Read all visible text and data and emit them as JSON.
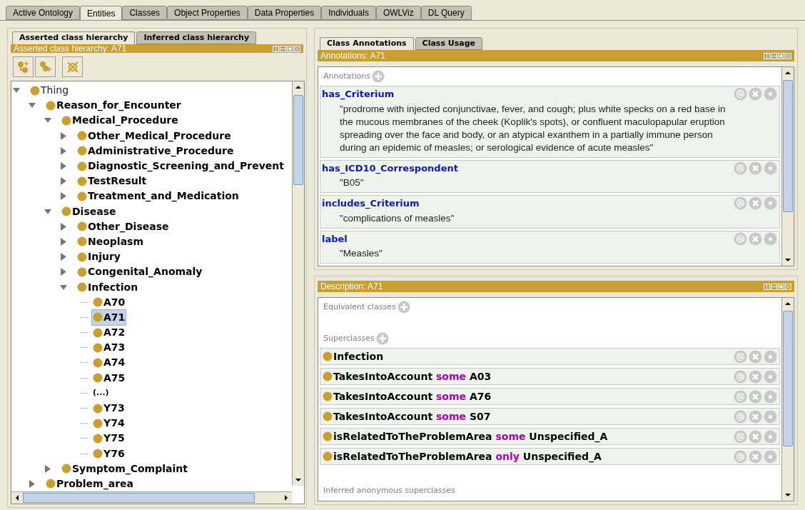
{
  "main_tabs": [
    {
      "label": "Active Ontology",
      "selected": false
    },
    {
      "label": "Entities",
      "selected": true
    },
    {
      "label": "Classes",
      "selected": false
    },
    {
      "label": "Object Properties",
      "selected": false
    },
    {
      "label": "Data Properties",
      "selected": false
    },
    {
      "label": "Individuals",
      "selected": false
    },
    {
      "label": "OWLViz",
      "selected": false
    },
    {
      "label": "DL Query",
      "selected": false
    }
  ],
  "hierarchy_tabs": [
    {
      "label": "Asserted class hierarchy",
      "selected": true
    },
    {
      "label": "Inferred class hierarchy",
      "selected": false
    }
  ],
  "hierarchy_panel": {
    "title": "Asserted class hierarchy: A71",
    "tree": [
      {
        "label": "Thing",
        "kind": "class",
        "expanded": true,
        "selected": false,
        "children": [
          {
            "label": "Reason_for_Encounter",
            "kind": "class",
            "expanded": true,
            "selected": false,
            "children": [
              {
                "label": "Medical_Procedure",
                "kind": "class",
                "expanded": true,
                "selected": false,
                "children": [
                  {
                    "label": "Other_Medical_Procedure",
                    "kind": "class",
                    "expanded": false,
                    "selected": false
                  },
                  {
                    "label": "Administrative_Procedure",
                    "kind": "class",
                    "expanded": false,
                    "selected": false
                  },
                  {
                    "label": "Diagnostic_Screening_and_Prevent",
                    "kind": "class",
                    "expanded": false,
                    "selected": false
                  },
                  {
                    "label": "TestResult",
                    "kind": "class",
                    "expanded": false,
                    "selected": false
                  },
                  {
                    "label": "Treatment_and_Medication",
                    "kind": "class",
                    "expanded": false,
                    "selected": false
                  }
                ]
              },
              {
                "label": "Disease",
                "kind": "class",
                "expanded": true,
                "selected": false,
                "children": [
                  {
                    "label": "Other_Disease",
                    "kind": "class",
                    "expanded": false,
                    "selected": false
                  },
                  {
                    "label": "Neoplasm",
                    "kind": "class",
                    "expanded": false,
                    "selected": false
                  },
                  {
                    "label": "Injury",
                    "kind": "class",
                    "expanded": false,
                    "selected": false
                  },
                  {
                    "label": "Congenital_Anomaly",
                    "kind": "class",
                    "expanded": false,
                    "selected": false
                  },
                  {
                    "label": "Infection",
                    "kind": "class",
                    "expanded": true,
                    "selected": false,
                    "children": [
                      {
                        "label": "A70",
                        "kind": "class",
                        "selected": false
                      },
                      {
                        "label": "A71",
                        "kind": "class",
                        "selected": true
                      },
                      {
                        "label": "A72",
                        "kind": "class",
                        "selected": false
                      },
                      {
                        "label": "A73",
                        "kind": "class",
                        "selected": false
                      },
                      {
                        "label": "A74",
                        "kind": "class",
                        "selected": false
                      },
                      {
                        "label": "A75",
                        "kind": "class",
                        "selected": false
                      },
                      {
                        "label": "(...)",
                        "kind": "ellipsis",
                        "selected": false
                      },
                      {
                        "label": "Y73",
                        "kind": "class",
                        "selected": false
                      },
                      {
                        "label": "Y74",
                        "kind": "class",
                        "selected": false
                      },
                      {
                        "label": "Y75",
                        "kind": "class",
                        "selected": false
                      },
                      {
                        "label": "Y76",
                        "kind": "class",
                        "selected": false
                      }
                    ]
                  }
                ]
              },
              {
                "label": "Symptom_Complaint",
                "kind": "class",
                "expanded": false,
                "selected": false
              }
            ]
          },
          {
            "label": "Problem_area",
            "kind": "class",
            "expanded": false,
            "selected": false
          }
        ]
      }
    ]
  },
  "detail_tabs": [
    {
      "label": "Class Annotations",
      "selected": true
    },
    {
      "label": "Class Usage",
      "selected": false
    }
  ],
  "annotations_panel": {
    "title": "Annotations: A71",
    "section": "Annotations",
    "annotations": [
      {
        "property": "has_Criterium",
        "value": "\"prodrome with injected conjunctivae, fever, and cough; plus white specks on a red base in the mucous membranes of the cheek (Koplik's spots), or confluent maculopapular eruption spreading over the face and body, or an atypical exanthem in a partially immune person during an epidemic of measles; or serological evidence of acute measles\""
      },
      {
        "property": "has_ICD10_Correspondent",
        "value": "\"B05\""
      },
      {
        "property": "includes_Criterium",
        "value": "\"complications of measles\""
      },
      {
        "property": "label",
        "value": "\"Measles\""
      }
    ]
  },
  "description_panel": {
    "title": "Description: A71",
    "equivalent_heading": "Equivalent classes",
    "superclasses_heading": "Superclasses",
    "inferred_heading": "Inferred anonymous superclasses",
    "superclasses": [
      {
        "kind": "class",
        "subject": "Infection"
      },
      {
        "kind": "restriction",
        "subject": "TakesIntoAccount",
        "keyword": "some",
        "object": "A03"
      },
      {
        "kind": "restriction",
        "subject": "TakesIntoAccount",
        "keyword": "some",
        "object": "A76"
      },
      {
        "kind": "restriction",
        "subject": "TakesIntoAccount",
        "keyword": "some",
        "object": "S07"
      },
      {
        "kind": "restriction",
        "subject": "isRelatedToTheProblemArea",
        "keyword": "some",
        "object": "Unspecified_A"
      },
      {
        "kind": "restriction",
        "subject": "isRelatedToTheProblemArea",
        "keyword": "only",
        "object": "Unspecified_A"
      }
    ]
  }
}
